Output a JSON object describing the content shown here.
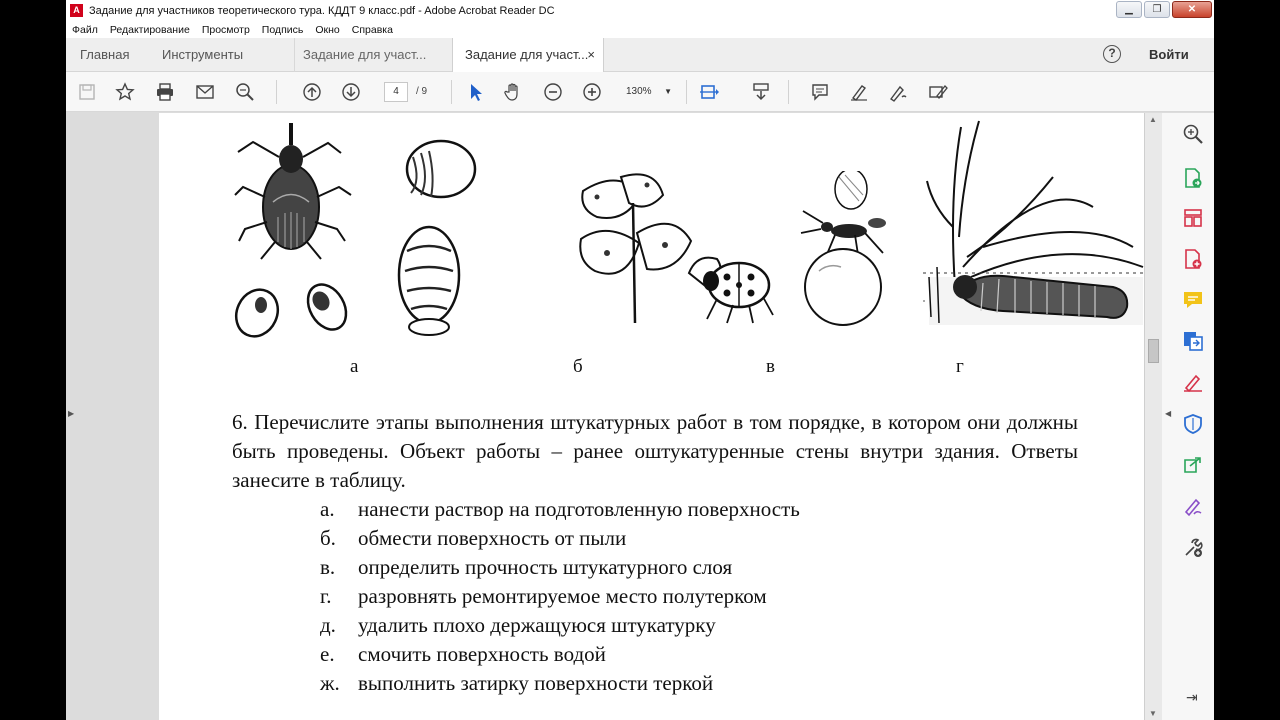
{
  "window": {
    "title": "Задание для участников теоретического тура. КДДТ 9 класс.pdf - Adobe Acrobat Reader DC",
    "minimize": "▁",
    "maximize": "❐",
    "close": "✕"
  },
  "menu": [
    "Файл",
    "Редактирование",
    "Просмотр",
    "Подпись",
    "Окно",
    "Справка"
  ],
  "tabs": {
    "home": "Главная",
    "tools": "Инструменты",
    "doc1": "Задание для участ...",
    "doc2": "Задание для участ...",
    "close_glyph": "×"
  },
  "help": "?",
  "signin": "Войти",
  "toolbar": {
    "current_page": "4",
    "total_pages": "/ 9",
    "zoom": "130%"
  },
  "document": {
    "captions": [
      "а",
      "б",
      "в",
      "г"
    ],
    "question": "6. Перечислите этапы выполнения штукатурных работ в том порядке, в котором они должны быть проведены. Объект работы – ранее оштукатуренные стены внутри здания. Ответы занесите в таблицу.",
    "options": [
      {
        "letter": "а.",
        "text": "нанести раствор на подготовленную поверхность"
      },
      {
        "letter": "б.",
        "text": "обмести поверхность от пыли"
      },
      {
        "letter": "в.",
        "text": "определить прочность штукатурного слоя"
      },
      {
        "letter": "г.",
        "text": "разровнять ремонтируемое место полутерком"
      },
      {
        "letter": "д.",
        "text": "удалить плохо держащуюся штукатурку"
      },
      {
        "letter": "е.",
        "text": "смочить поверхность водой"
      },
      {
        "letter": "ж.",
        "text": "выполнить затирку поверхности теркой"
      }
    ]
  },
  "colors": {
    "accent_red": "#d6334a",
    "accent_blue": "#2d6fd3",
    "accent_green": "#2aa55a",
    "accent_yellow": "#f2c318",
    "accent_purple": "#8a4fc8"
  }
}
